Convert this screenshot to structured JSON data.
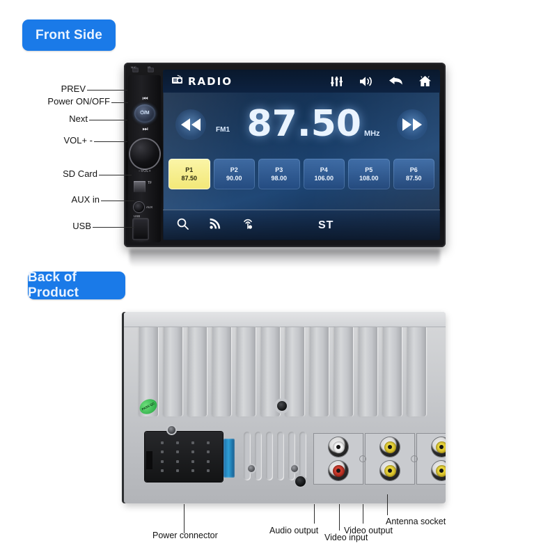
{
  "sections": {
    "front_badge": "Front Side",
    "back_badge": "Back of Product"
  },
  "front_unit": {
    "sensors": {
      "mic": "MIC",
      "ir": "IR"
    },
    "controls": {
      "prev_glyph": "⏮",
      "power_label": "⏻/M",
      "next_glyph": "⏭",
      "volume_mark": "−VOL+",
      "tf_label": "TF",
      "aux_label": "AUX",
      "aux_side_label": "AUX",
      "usb_label": "USB"
    },
    "callouts": [
      {
        "label": "PREV"
      },
      {
        "label": "Power ON/OFF"
      },
      {
        "label": "Next"
      },
      {
        "label": "VOL+ -"
      },
      {
        "label": "SD Card"
      },
      {
        "label": "AUX in"
      },
      {
        "label": "USB"
      }
    ],
    "screen": {
      "brand": "RADIO",
      "brand_icon": "radio-icon",
      "topbar_icons": [
        "equalizer-icon",
        "volume-icon",
        "back-arrow-icon",
        "home-icon"
      ],
      "band": "FM1",
      "frequency": "87.50",
      "unit": "MHz",
      "seek_down_icon": "seek-backward-icon",
      "seek_up_icon": "seek-forward-icon",
      "presets": [
        {
          "num": "P1",
          "freq": "87.50",
          "active": true
        },
        {
          "num": "P2",
          "freq": "90.00",
          "active": false
        },
        {
          "num": "P3",
          "freq": "98.00",
          "active": false
        },
        {
          "num": "P4",
          "freq": "106.00",
          "active": false
        },
        {
          "num": "P5",
          "freq": "108.00",
          "active": false
        },
        {
          "num": "P6",
          "freq": "87.50",
          "active": false
        }
      ],
      "bottom_icons": [
        "search-icon",
        "signal-icon",
        "tune-touch-icon"
      ],
      "stereo_label": "ST"
    }
  },
  "back_unit": {
    "sticker_text": "PASS QC",
    "callouts": [
      {
        "label": "Power connector"
      },
      {
        "label": "Audio output"
      },
      {
        "label": "Video input"
      },
      {
        "label": "Video output"
      },
      {
        "label": "Antenna socket"
      }
    ]
  },
  "colors": {
    "badge_blue": "#1a7ae8",
    "preset_active": "#f2e877",
    "screen_blue": "#16365c",
    "antenna_olive": "#8d8a25"
  }
}
